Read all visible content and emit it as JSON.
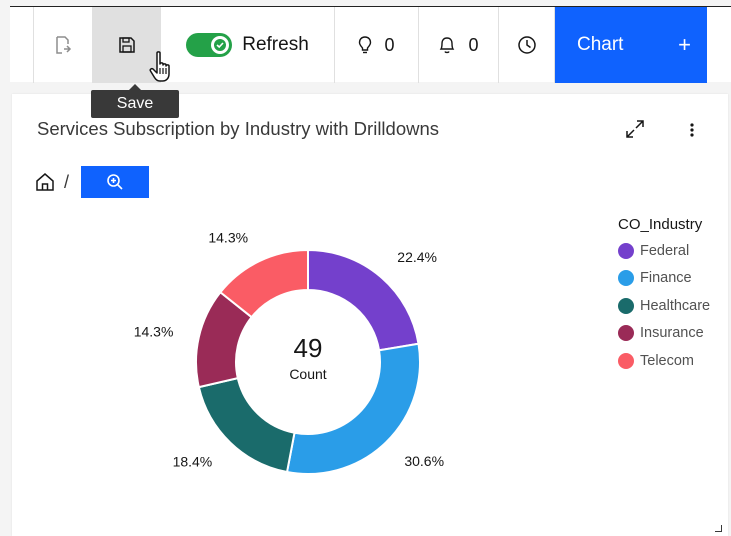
{
  "toolbar": {
    "refresh_label": "Refresh",
    "ideas_count": "0",
    "notifications_count": "0",
    "chart_button_label": "Chart",
    "chart_button_plus": "+",
    "save_tooltip": "Save",
    "toggle_on": true,
    "accent_color": "#0f62fe",
    "toggle_color": "#24a148"
  },
  "card": {
    "title": "Services Subscription by Industry with Drilldowns",
    "breadcrumb_separator": "/"
  },
  "chart_data": {
    "type": "donut",
    "title": "Services Subscription by Industry with Drilldowns",
    "center_value": "49",
    "center_label": "Count",
    "legend_title": "CO_Industry",
    "categories": [
      "Federal",
      "Finance",
      "Healthcare",
      "Insurance",
      "Telecom"
    ],
    "values": [
      22.4,
      30.6,
      18.4,
      14.3,
      14.3
    ],
    "value_labels": [
      "22.4%",
      "30.6%",
      "18.4%",
      "14.3%",
      "14.3%"
    ],
    "colors": [
      "#7440cc",
      "#2a9de8",
      "#1a6b6b",
      "#9a2b57",
      "#fa5c65"
    ],
    "legend_placement": "right"
  }
}
